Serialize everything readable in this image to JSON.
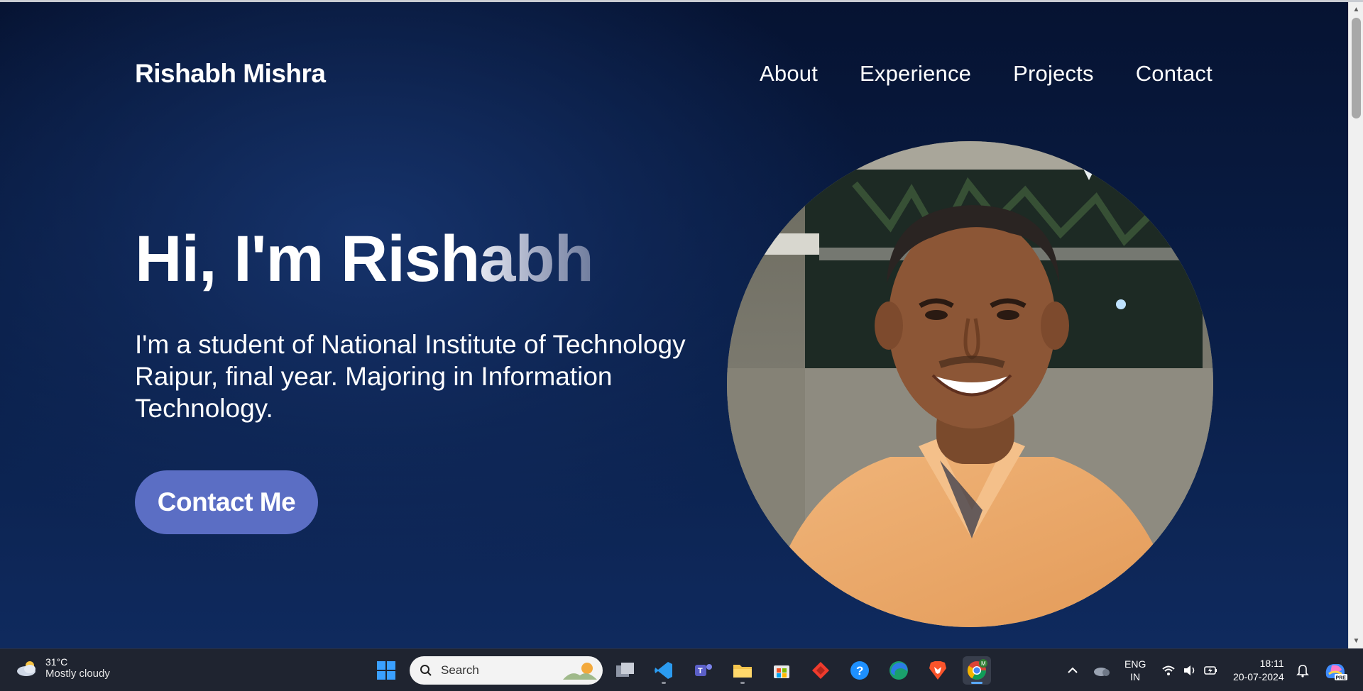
{
  "site": {
    "brand": "Rishabh Mishra",
    "nav": [
      "About",
      "Experience",
      "Projects",
      "Contact"
    ],
    "hero": {
      "greeting_solid": "Hi, I'm Rish",
      "greeting_fade": "abh",
      "description": "I'm a student of National Institute of Technology Raipur, final year. Majoring in Information Technology.",
      "cta_label": "Contact Me"
    }
  },
  "taskbar": {
    "weather_temp": "31°C",
    "weather_text": "Mostly cloudy",
    "search_placeholder": "Search",
    "lang_top": "ENG",
    "lang_bottom": "IN",
    "time": "18:11",
    "date": "20-07-2024",
    "copilot_badge": "PRE",
    "chrome_profile": "M"
  },
  "colors": {
    "accent_button": "#5b6ec4",
    "page_bg": "#0b1a3a",
    "taskbar_bg": "#1f2430"
  }
}
